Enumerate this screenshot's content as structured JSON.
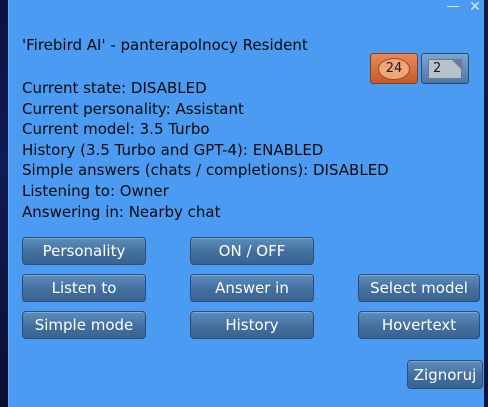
{
  "window": {
    "minimize_symbol": "—",
    "close_symbol": "✕"
  },
  "dialog": {
    "title": "'Firebird AI' - panterapolnocy Resident",
    "lines": [
      "Current state: DISABLED",
      "Current personality: Assistant",
      "Current model: 3.5 Turbo",
      "History (3.5 Turbo and GPT-4): ENABLED",
      "Simple answers (chats / completions): DISABLED",
      "Listening to: Owner",
      "Answering in: Nearby chat"
    ]
  },
  "counters": {
    "notifications": "24",
    "messages": "2"
  },
  "buttons": {
    "personality": "Personality",
    "on_off": "ON / OFF",
    "listen_to": "Listen to",
    "answer_in": "Answer in",
    "select_model": "Select model",
    "simple_mode": "Simple mode",
    "history": "History",
    "hovertext": "Hovertext",
    "ignore": "Zignoruj"
  },
  "colors": {
    "dialog_background": "#4a9bf1",
    "button_fill": "#436f9e",
    "notification_counter": "#d06a38",
    "text": "#0a0a0a"
  },
  "icons": {
    "notification": "orange-oval-badge",
    "messages": "envelope-icon"
  }
}
